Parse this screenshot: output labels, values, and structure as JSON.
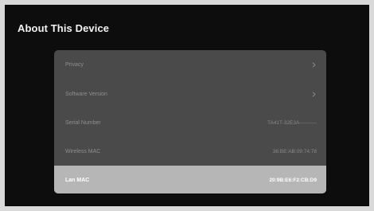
{
  "page": {
    "title": "About This Device"
  },
  "list": {
    "items": [
      {
        "label": "Privacy",
        "value": "",
        "icon": "chevron-right-icon"
      },
      {
        "label": "Software Version",
        "value": "",
        "icon": "chevron-right-icon"
      },
      {
        "label": "Serial Number",
        "value": "TA41T-32E3A----------"
      },
      {
        "label": "Wireless MAC",
        "value": "36:BE:AB:09:74:78"
      },
      {
        "label": "Lan MAC",
        "value": "20:9B:E6:F2:CB:D9",
        "selected": true
      }
    ]
  },
  "colors": {
    "background": "#0d0d0d",
    "panel": "#4a4a4a",
    "selected_row": "#b6b6b6",
    "text_dim": "#8f8f8f",
    "text_bright": "#ffffff"
  }
}
